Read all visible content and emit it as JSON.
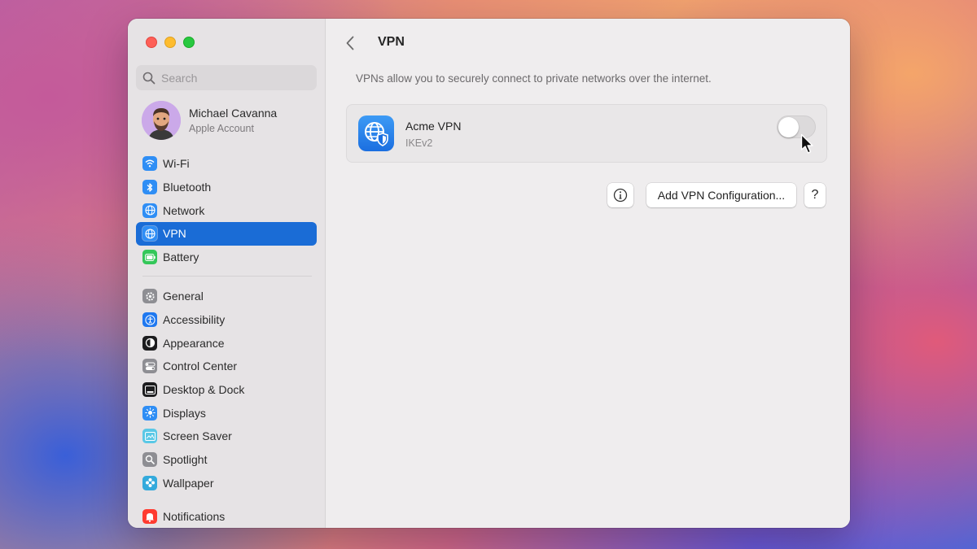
{
  "window": {
    "traffic_lights": [
      "close",
      "minimize",
      "maximize"
    ]
  },
  "sidebar": {
    "search": {
      "placeholder": "Search",
      "icon": "search-icon"
    },
    "account": {
      "name": "Michael Cavanna",
      "subtitle": "Apple Account"
    },
    "group1": [
      {
        "label": "Wi-Fi",
        "icon": "wifi-icon",
        "color": "#2f8ef5"
      },
      {
        "label": "Bluetooth",
        "icon": "bluetooth-icon",
        "color": "#2f8ef5"
      },
      {
        "label": "Network",
        "icon": "globe-icon",
        "color": "#2f8ef5"
      },
      {
        "label": "VPN",
        "icon": "vpn-globe-icon",
        "color": "#2f8ef5",
        "active": true
      },
      {
        "label": "Battery",
        "icon": "battery-icon",
        "color": "#34c759"
      }
    ],
    "group2": [
      {
        "label": "General",
        "icon": "gear-icon",
        "color": "#8e8e93"
      },
      {
        "label": "Accessibility",
        "icon": "accessibility-icon",
        "color": "#1f78f0"
      },
      {
        "label": "Appearance",
        "icon": "appearance-icon",
        "color": "#1c1c1e"
      },
      {
        "label": "Control Center",
        "icon": "control-center-icon",
        "color": "#8e8e93"
      },
      {
        "label": "Desktop & Dock",
        "icon": "dock-icon",
        "color": "#1c1c1e"
      },
      {
        "label": "Displays",
        "icon": "sun-icon",
        "color": "#2f8ef5"
      },
      {
        "label": "Screen Saver",
        "icon": "screen-saver-icon",
        "color": "#5ac8e6"
      },
      {
        "label": "Spotlight",
        "icon": "magnifier-icon",
        "color": "#8e8e93"
      },
      {
        "label": "Wallpaper",
        "icon": "flower-icon",
        "color": "#34aadc"
      }
    ],
    "group3": [
      {
        "label": "Notifications",
        "icon": "bell-icon",
        "color": "#ff3b30"
      }
    ]
  },
  "main": {
    "title": "VPN",
    "description": "VPNs allow you to securely connect to private networks over the internet.",
    "vpn": {
      "name": "Acme VPN",
      "protocol": "IKEv2",
      "enabled": false
    },
    "buttons": {
      "info": "ⓘ",
      "add": "Add VPN Configuration...",
      "help": "?"
    }
  },
  "colors": {
    "accent": "#1a6cd6",
    "sidebar_bg": "#e6e3e5",
    "content_bg": "#efedee"
  }
}
